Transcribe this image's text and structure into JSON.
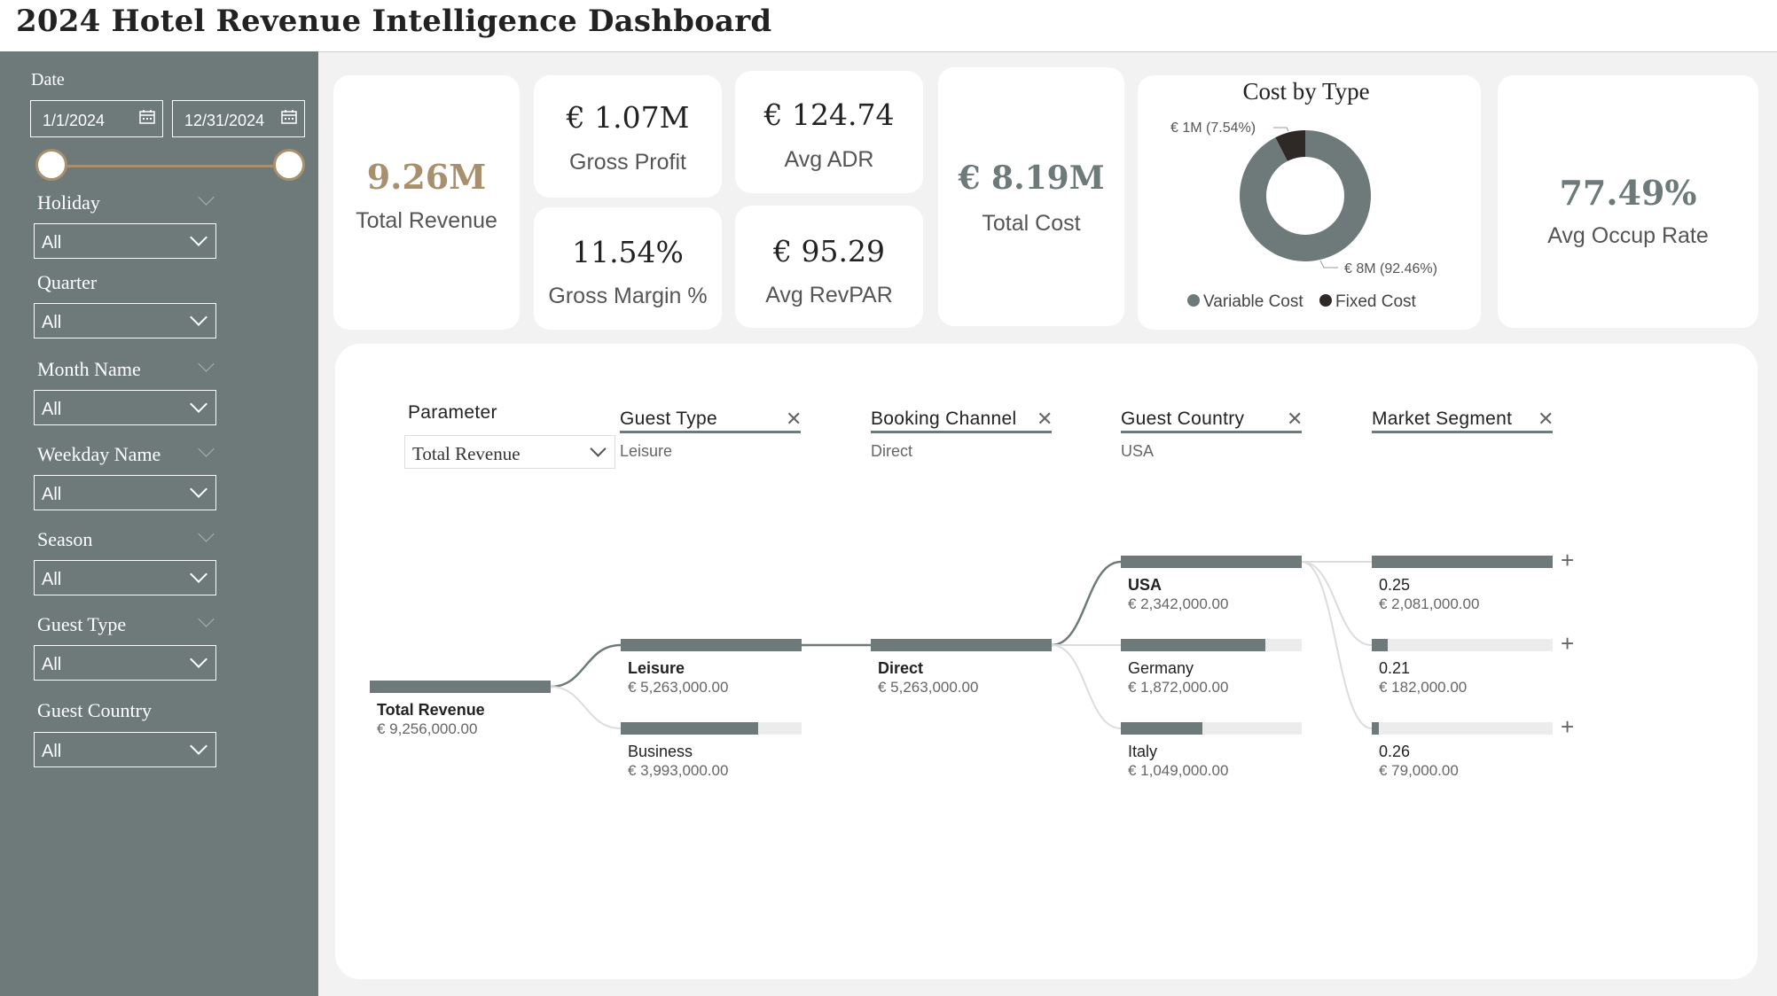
{
  "header": {
    "title": "2024 Hotel Revenue Intelligence Dashboard"
  },
  "sidebar": {
    "date": {
      "label": "Date",
      "start": "1/1/2024",
      "end": "12/31/2024"
    },
    "filters": [
      {
        "label": "Holiday",
        "value": "All"
      },
      {
        "label": "Quarter",
        "value": "All"
      },
      {
        "label": "Month Name",
        "value": "All"
      },
      {
        "label": "Weekday Name",
        "value": "All"
      },
      {
        "label": "Season",
        "value": "All"
      },
      {
        "label": "Guest Type",
        "value": "All"
      },
      {
        "label": "Guest Country",
        "value": "All"
      }
    ]
  },
  "kpis": {
    "total_revenue": {
      "value": "9.26M",
      "label": "Total Revenue"
    },
    "gross_profit": {
      "value": "€ 1.07M",
      "label": "Gross Profit"
    },
    "avg_adr": {
      "value": "€ 124.74",
      "label": "Avg ADR"
    },
    "gross_margin": {
      "value": "11.54%",
      "label": "Gross Margin %"
    },
    "avg_revpar": {
      "value": "€ 95.29",
      "label": "Avg RevPAR"
    },
    "total_cost": {
      "value": "€ 8.19M",
      "label": "Total Cost"
    },
    "avg_occup": {
      "value": "77.49%",
      "label": "Avg Occup Rate"
    }
  },
  "cost_chart": {
    "title": "Cost by Type",
    "fixed_label": "€ 1M (7.54%)",
    "variable_label": "€ 8M (92.46%)",
    "legend": [
      "Variable Cost",
      "Fixed Cost"
    ]
  },
  "chart_data": {
    "type": "pie",
    "title": "Cost by Type",
    "labels": [
      "Variable Cost",
      "Fixed Cost"
    ],
    "values": [
      92.46,
      7.54
    ],
    "colors": [
      "#6e7a7a",
      "#2e2826"
    ]
  },
  "colors": {
    "accent": "#a8906e",
    "slate": "#6e7a7a",
    "dark": "#2e2826"
  },
  "tree": {
    "parameter": {
      "label": "Parameter",
      "value": "Total Revenue"
    },
    "levels": [
      {
        "label": "Guest Type",
        "selected": "Leisure"
      },
      {
        "label": "Booking Channel",
        "selected": "Direct"
      },
      {
        "label": "Guest Country",
        "selected": "USA"
      },
      {
        "label": "Market Segment",
        "selected": ""
      }
    ],
    "root": {
      "name": "Total Revenue",
      "amount": "€ 9,256,000.00",
      "fill": 1.0
    },
    "guest_type": [
      {
        "name": "Leisure",
        "amount": "€ 5,263,000.00",
        "fill": 1.0
      },
      {
        "name": "Business",
        "amount": "€ 3,993,000.00",
        "fill": 0.76
      }
    ],
    "channel": [
      {
        "name": "Direct",
        "amount": "€ 5,263,000.00",
        "fill": 1.0
      }
    ],
    "country": [
      {
        "name": "USA",
        "amount": "€ 2,342,000.00",
        "fill": 1.0
      },
      {
        "name": "Germany",
        "amount": "€ 1,872,000.00",
        "fill": 0.8
      },
      {
        "name": "Italy",
        "amount": "€ 1,049,000.00",
        "fill": 0.45
      }
    ],
    "segment": [
      {
        "name": "0.25",
        "amount": "€ 2,081,000.00",
        "fill": 1.0
      },
      {
        "name": "0.21",
        "amount": "€ 182,000.00",
        "fill": 0.087
      },
      {
        "name": "0.26",
        "amount": "€ 79,000.00",
        "fill": 0.038
      }
    ]
  }
}
